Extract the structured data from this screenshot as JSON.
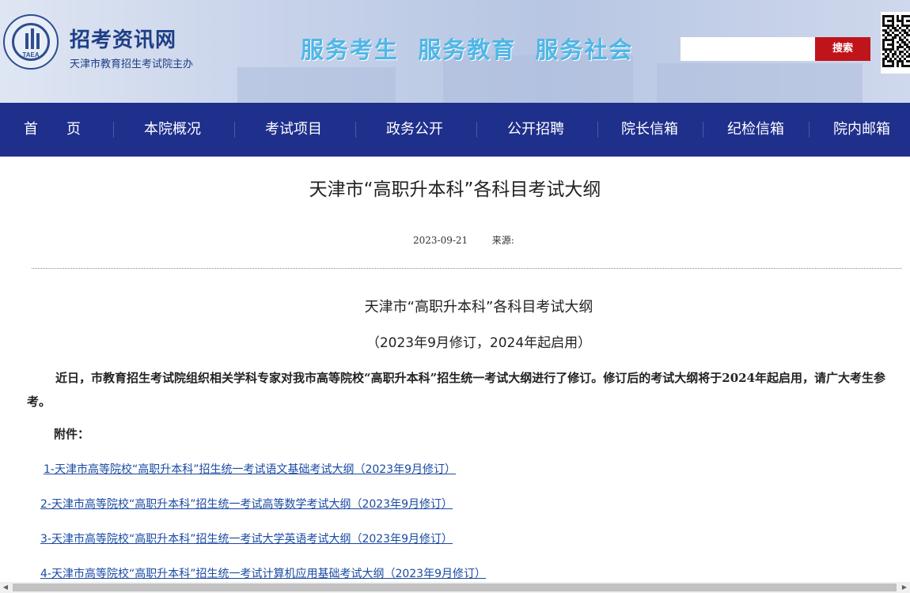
{
  "header": {
    "logo_text": "TAEA",
    "site_name": "招考资讯网",
    "site_subtitle": "天津市教育招生考试院主办",
    "slogan": "服务考生  服务教育  服务社会",
    "search": {
      "value": "",
      "placeholder": "",
      "button_label": "搜索"
    }
  },
  "nav": {
    "items": [
      "首　　页",
      "本院概况",
      "考试项目",
      "政务公开",
      "公开招聘",
      "院长信箱",
      "纪检信箱",
      "院内邮箱"
    ],
    "bg_color": "#1f2f8c"
  },
  "article": {
    "title": "天津市“高职升本科”各科目考试大纲",
    "date": "2023-09-21",
    "source_label": "来源:",
    "sub_title": "天津市“高职升本科”各科目考试大纲",
    "sub_note": "（2023年9月修订，2024年起启用）",
    "paragraph": "近日，市教育招生考试院组织相关学科专家对我市高等院校“高职升本科”招生统一考试大纲进行了修订。修订后的考试大纲将于2024年起启用，请广大考生参考。",
    "attachments_label": "附件：",
    "attachments": [
      "1-天津市高等院校“高职升本科”招生统一考试语文基础考试大纲（2023年9月修订）",
      "2-天津市高等院校“高职升本科”招生统一考试高等数学考试大纲（2023年9月修订）",
      "3-天津市高等院校“高职升本科”招生统一考试大学英语考试大纲（2023年9月修订）",
      "4-天津市高等院校“高职升本科”招生统一考试计算机应用基础考试大纲（2023年9月修订）"
    ]
  },
  "colors": {
    "link": "#1a4aa3",
    "search_button": "#c0141b",
    "slogan": "#4fb7e6"
  }
}
